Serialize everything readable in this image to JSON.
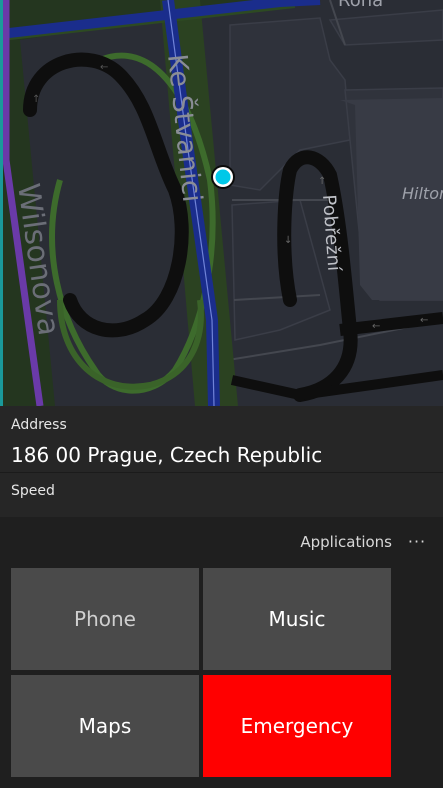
{
  "map": {
    "street_labels": [
      "Wilsonova",
      "Ke Štvanici",
      "Pobřežní",
      "Hilton",
      "Rohá"
    ],
    "colors": {
      "background": "#2a2d35",
      "blocks": "#30333c",
      "building": "#3a3d46",
      "major_road": "#1a2d8c",
      "green_band": "#2d4a22",
      "ramp": "#0e0e0e",
      "location_dot": "#00c8e8"
    },
    "icons": [
      "location-dot-icon"
    ]
  },
  "address": {
    "label": "Address",
    "value": "186 00 Prague, Czech Republic"
  },
  "speed": {
    "label": "Speed"
  },
  "applications": {
    "header": "Applications",
    "more_icon": "more-icon",
    "more_glyph": "···",
    "tiles": [
      {
        "label": "Phone"
      },
      {
        "label": "Music"
      },
      {
        "label": "Maps"
      },
      {
        "label": "Emergency",
        "color": "#ff0000"
      }
    ]
  }
}
